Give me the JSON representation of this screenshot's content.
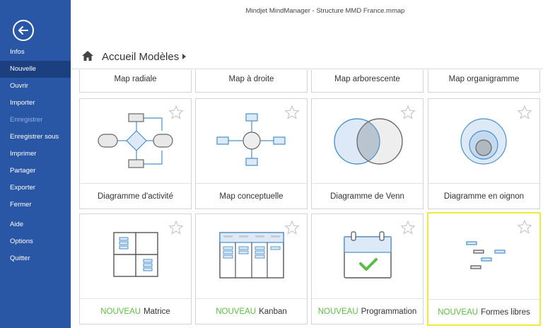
{
  "window": {
    "title": "Mindjet MindManager - Structure MMD France.mmap"
  },
  "sidebar": {
    "back_icon": "back-arrow-icon",
    "items": [
      {
        "label": "Infos",
        "state": "normal"
      },
      {
        "label": "Nouvelle",
        "state": "active"
      },
      {
        "label": "Ouvrir",
        "state": "normal"
      },
      {
        "label": "Importer",
        "state": "normal"
      },
      {
        "label": "Enregistrer",
        "state": "disabled"
      },
      {
        "label": "Enregistrer sous",
        "state": "normal"
      },
      {
        "label": "Imprimer",
        "state": "normal"
      },
      {
        "label": "Partager",
        "state": "normal"
      },
      {
        "label": "Exporter",
        "state": "normal"
      },
      {
        "label": "Fermer",
        "state": "normal"
      },
      {
        "label": "Aide",
        "state": "normal"
      },
      {
        "label": "Options",
        "state": "normal"
      },
      {
        "label": "Quitter",
        "state": "normal"
      }
    ]
  },
  "breadcrumb": {
    "home_icon": "home-icon",
    "label": "Accueil Modèles"
  },
  "templates_row0": [
    {
      "label": "Map radiale"
    },
    {
      "label": "Map à droite"
    },
    {
      "label": "Map arborescente"
    },
    {
      "label": "Map organigramme"
    }
  ],
  "templates_row1": [
    {
      "label": "Diagramme d'activité",
      "icon": "activity-diagram-icon"
    },
    {
      "label": "Map conceptuelle",
      "icon": "concept-map-icon"
    },
    {
      "label": "Diagramme de Venn",
      "icon": "venn-diagram-icon"
    },
    {
      "label": "Diagramme en oignon",
      "icon": "onion-diagram-icon"
    }
  ],
  "templates_row2": [
    {
      "badge": "NOUVEAU",
      "label": "Matrice",
      "icon": "matrix-icon"
    },
    {
      "badge": "NOUVEAU",
      "label": "Kanban",
      "icon": "kanban-icon"
    },
    {
      "badge": "NOUVEAU",
      "label": "Programmation",
      "icon": "calendar-check-icon"
    },
    {
      "badge": "NOUVEAU",
      "label": "Formes libres",
      "icon": "freeform-icon"
    }
  ],
  "colors": {
    "sidebar": "#2a56a6",
    "sidebar_active": "#1c3f80",
    "new_badge": "#5dbb46",
    "selection": "#f2ea3a",
    "accent_blue": "#4a90c8"
  }
}
